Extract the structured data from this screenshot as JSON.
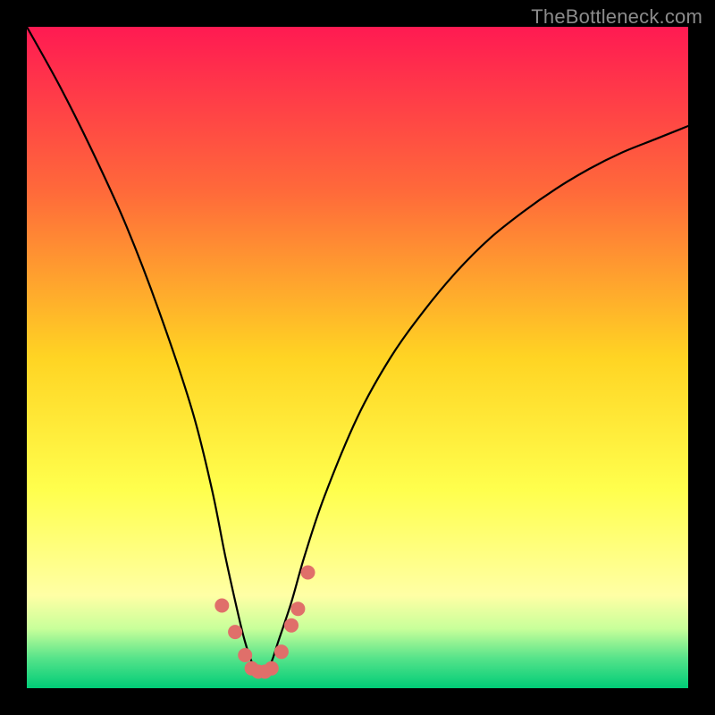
{
  "watermark": "TheBottleneck.com",
  "chart_data": {
    "type": "line",
    "title": "",
    "xlabel": "",
    "ylabel": "",
    "xlim": [
      0,
      100
    ],
    "ylim": [
      0,
      100
    ],
    "grid": false,
    "legend": false,
    "gradient_stops": [
      {
        "offset": 0.0,
        "color": "#ff1a52"
      },
      {
        "offset": 0.25,
        "color": "#ff6a3a"
      },
      {
        "offset": 0.5,
        "color": "#ffd423"
      },
      {
        "offset": 0.7,
        "color": "#ffff4d"
      },
      {
        "offset": 0.86,
        "color": "#ffffa5"
      },
      {
        "offset": 0.91,
        "color": "#c8ff9a"
      },
      {
        "offset": 0.955,
        "color": "#55e38a"
      },
      {
        "offset": 1.0,
        "color": "#00cc77"
      }
    ],
    "series": [
      {
        "name": "bottleneck-curve",
        "x": [
          0,
          5,
          10,
          15,
          20,
          25,
          28,
          30,
          32,
          33,
          34,
          35,
          36,
          37,
          38,
          40,
          42,
          45,
          50,
          55,
          60,
          65,
          70,
          75,
          80,
          85,
          90,
          95,
          100
        ],
        "y": [
          100,
          91,
          81,
          70,
          57,
          42,
          30,
          20,
          11,
          7,
          4,
          2.5,
          2.5,
          4,
          7,
          13,
          20,
          29,
          41,
          50,
          57,
          63,
          68,
          72,
          75.5,
          78.5,
          81,
          83,
          85
        ]
      }
    ],
    "markers": {
      "name": "highlight-dots",
      "color": "#e06f6a",
      "radius": 8,
      "x": [
        29.5,
        31.5,
        33.0,
        34.0,
        35.0,
        36.0,
        37.0,
        38.5,
        40.0,
        41.0,
        42.5
      ],
      "y": [
        12.5,
        8.5,
        5.0,
        3.0,
        2.5,
        2.5,
        3.0,
        5.5,
        9.5,
        12.0,
        17.5
      ]
    }
  }
}
